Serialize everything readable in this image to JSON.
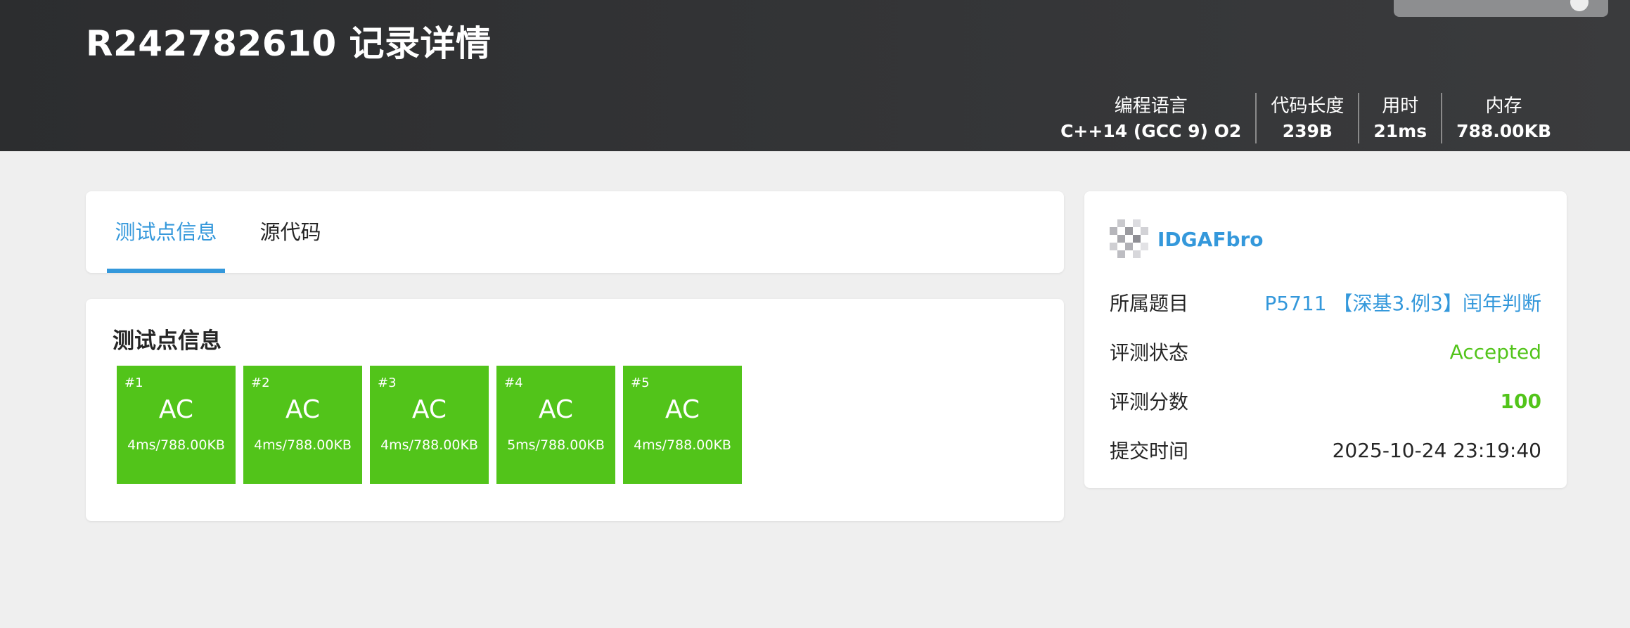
{
  "header": {
    "title": "R242782610 记录详情",
    "stats": [
      {
        "label": "编程语言",
        "value": "C++14 (GCC 9) O2"
      },
      {
        "label": "代码长度",
        "value": "239B"
      },
      {
        "label": "用时",
        "value": "21ms"
      },
      {
        "label": "内存",
        "value": "788.00KB"
      }
    ]
  },
  "tabs": [
    {
      "label": "测试点信息",
      "active": true
    },
    {
      "label": "源代码",
      "active": false
    }
  ],
  "tests": {
    "title": "测试点信息",
    "cases": [
      {
        "id": "#1",
        "status": "AC",
        "detail": "4ms/788.00KB"
      },
      {
        "id": "#2",
        "status": "AC",
        "detail": "4ms/788.00KB"
      },
      {
        "id": "#3",
        "status": "AC",
        "detail": "4ms/788.00KB"
      },
      {
        "id": "#4",
        "status": "AC",
        "detail": "5ms/788.00KB"
      },
      {
        "id": "#5",
        "status": "AC",
        "detail": "4ms/788.00KB"
      }
    ]
  },
  "info": {
    "username": "IDGAFbro",
    "rows": [
      {
        "key": "所属题目",
        "value": "P5711 【深基3.例3】闰年判断"
      },
      {
        "key": "评测状态",
        "value": "Accepted"
      },
      {
        "key": "评测分数",
        "value": "100"
      },
      {
        "key": "提交时间",
        "value": "2025-10-24 23:19:40"
      }
    ]
  },
  "colors": {
    "accent": "#3498db",
    "accepted": "#52c41a",
    "header_bg": "#2c2d2f"
  }
}
